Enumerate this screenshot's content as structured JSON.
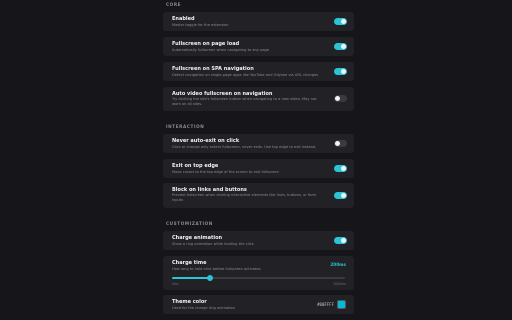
{
  "sections": {
    "core": "CORE",
    "interaction": "INTERACTION",
    "customization": "CUSTOMIZATION"
  },
  "settings": {
    "enabled": {
      "title": "Enabled",
      "desc": "Master toggle for the extension",
      "on": true
    },
    "fullscreen_page_load": {
      "title": "Fullscreen on page load",
      "desc": "Automatically fullscreen when navigating to any page",
      "on": true
    },
    "fullscreen_spa": {
      "title": "Fullscreen on SPA navigation",
      "desc": "Detect navigation on single-page apps like YouTube and Odysee via URL changes",
      "on": true
    },
    "auto_video": {
      "title": "Auto video fullscreen on navigation",
      "desc": "Try clicking the site's fullscreen button when navigating to a new video. May not work on all sites.",
      "on": false
    },
    "never_auto_exit": {
      "title": "Never auto-exit on click",
      "desc": "Click or change only enters fullscreen, never exits. Use top edge to exit instead.",
      "on": false
    },
    "exit_top_edge": {
      "title": "Exit on top edge",
      "desc": "Move cursor to the top edge of the screen to exit fullscreen",
      "on": true
    },
    "block_links": {
      "title": "Block on links and buttons",
      "desc": "Prevent fullscreen when clicking interactive elements like links, buttons, or form inputs",
      "on": true
    },
    "charge_animation": {
      "title": "Charge animation",
      "desc": "Show a ring animation while holding the click",
      "on": true
    }
  },
  "charge_time": {
    "title": "Charge time",
    "desc": "How long to hold click before fullscreen activates",
    "value_label": "200ms",
    "fraction": 0.22,
    "min_label": "0ms",
    "max_label": "1000ms"
  },
  "theme_color": {
    "title": "Theme color",
    "desc": "Used for the charge ring animation",
    "hex": "#00FFFF",
    "swatch": "#00bcd4"
  },
  "colors": {
    "accent": "#2bc4d6",
    "background": "#16161a",
    "card": "#212126"
  }
}
